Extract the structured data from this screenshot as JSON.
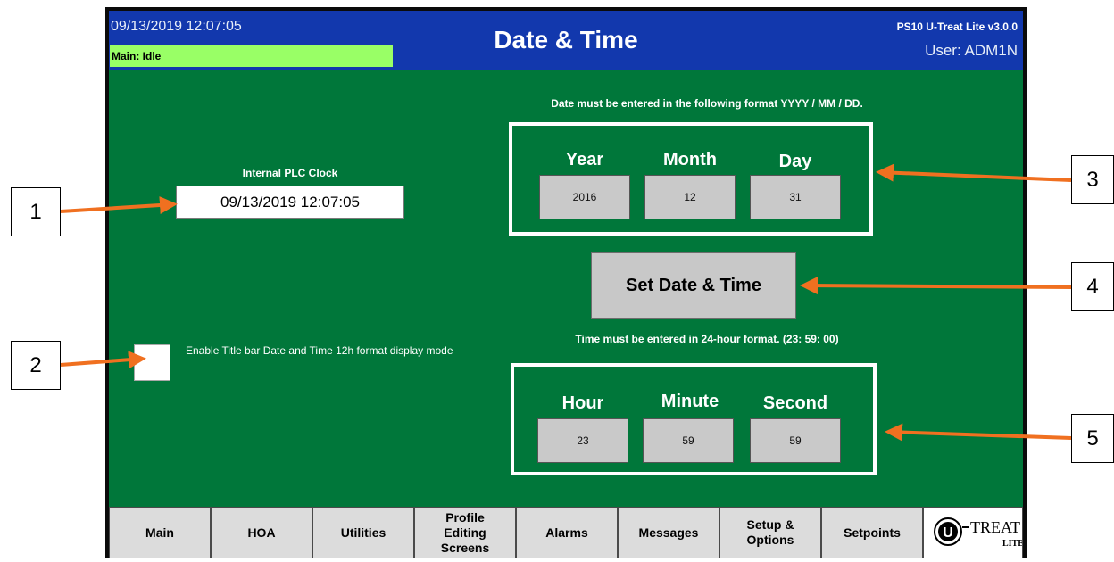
{
  "titlebar": {
    "datetime": "09/13/2019 12:07:05",
    "status": "Main: Idle",
    "title": "Date & Time",
    "version": "PS10 U-Treat Lite v3.0.0",
    "user": "User: ADM1N",
    "colors": {
      "bar": "#1238ad",
      "status": "#99ff66"
    }
  },
  "clock": {
    "label": "Internal PLC Clock",
    "value": "09/13/2019 12:07:05"
  },
  "format_toggle": {
    "checked": false,
    "label": "Enable Title bar Date and Time 12h format display mode"
  },
  "date": {
    "note": "Date must be entered in the following format YYYY / MM / DD.",
    "year_label": "Year",
    "year": "2016",
    "month_label": "Month",
    "month": "12",
    "day_label": "Day",
    "day": "31"
  },
  "set_button": "Set Date & Time",
  "time": {
    "note": "Time must be entered in 24-hour format. (23: 59: 00)",
    "hour_label": "Hour",
    "hour": "23",
    "minute_label": "Minute",
    "minute": "59",
    "second_label": "Second",
    "second": "59"
  },
  "nav": {
    "main": "Main",
    "hoa": "HOA",
    "utilities": "Utilities",
    "profile_l1": "Profile",
    "profile_l2": "Editing",
    "profile_l3": "Screens",
    "alarms": "Alarms",
    "messages": "Messages",
    "setup_l1": "Setup &",
    "setup_l2": "Options",
    "setpoints": "Setpoints",
    "logo_text": "TREAT",
    "logo_sub": "LITE"
  },
  "callouts": {
    "c1": "1",
    "c2": "2",
    "c3": "3",
    "c4": "4",
    "c5": "5"
  },
  "colors": {
    "panel": "#00773a",
    "arrow": "#f07020"
  }
}
